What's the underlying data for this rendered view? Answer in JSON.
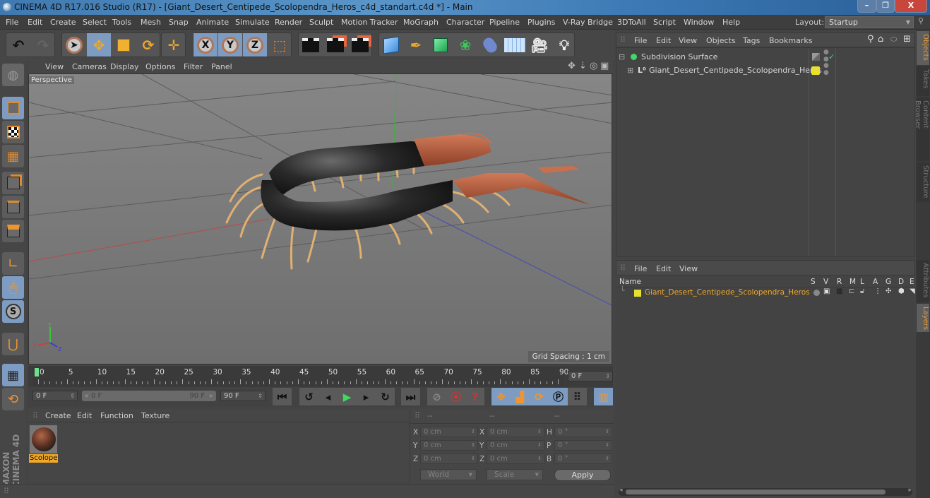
{
  "window": {
    "title": "CINEMA 4D R17.016 Studio (R17) - [Giant_Desert_Centipede_Scolopendra_Heros_c4d_standart.c4d *] - Main",
    "controls": {
      "minimize": "–",
      "maximize": "❐",
      "close": "X"
    }
  },
  "menubar": {
    "items": [
      "File",
      "Edit",
      "Create",
      "Select",
      "Tools",
      "Mesh",
      "Snap",
      "Animate",
      "Simulate",
      "Render",
      "Sculpt",
      "Motion Tracker",
      "MoGraph",
      "Character",
      "Pipeline",
      "Plugins",
      "V-Ray Bridge",
      "3DToAll",
      "Script",
      "Window",
      "Help"
    ],
    "layout_label": "Layout:",
    "layout_value": "Startup"
  },
  "toolbar": {
    "undo": "↶",
    "axis_labels": [
      "X",
      "Y",
      "Z"
    ]
  },
  "viewport": {
    "menu": [
      "View",
      "Cameras",
      "Display",
      "Options",
      "Filter",
      "Panel"
    ],
    "camera_label": "Perspective",
    "grid_spacing": "Grid Spacing : 1 cm",
    "colors": {
      "x_axis": "#c83c3c",
      "y_axis": "#3cc83c",
      "z_axis": "#3c3cc8",
      "bg": "#7b7b7b"
    }
  },
  "timeline": {
    "ticks": [
      "0",
      "5",
      "10",
      "15",
      "20",
      "25",
      "30",
      "35",
      "40",
      "45",
      "50",
      "55",
      "60",
      "65",
      "70",
      "75",
      "80",
      "85",
      "90"
    ],
    "current_frame": "0 F",
    "start_field": "0 F",
    "range_start": "0 F",
    "range_end": "90 F",
    "end_field": "90 F"
  },
  "material_manager": {
    "menu": [
      "Create",
      "Edit",
      "Function",
      "Texture"
    ],
    "materials": [
      {
        "name": "Scolope"
      }
    ]
  },
  "coordinates": {
    "headers": [
      "--",
      "--",
      "--"
    ],
    "rows": [
      {
        "pos_label": "X",
        "pos": "0 cm",
        "size_label": "X",
        "size": "0 cm",
        "rot_label": "H",
        "rot": "0 °"
      },
      {
        "pos_label": "Y",
        "pos": "0 cm",
        "size_label": "Y",
        "size": "0 cm",
        "rot_label": "P",
        "rot": "0 °"
      },
      {
        "pos_label": "Z",
        "pos": "0 cm",
        "size_label": "Z",
        "size": "0 cm",
        "rot_label": "B",
        "rot": "0 °"
      }
    ],
    "mode": "World",
    "transform": "Scale",
    "apply": "Apply"
  },
  "object_manager": {
    "menu": [
      "File",
      "Edit",
      "View",
      "Objects",
      "Tags",
      "Bookmarks"
    ],
    "objects": [
      {
        "name": "Subdivision Surface",
        "expand": "⊟",
        "icon_color": "#3fd86a"
      },
      {
        "name": "Giant_Desert_Centipede_Scolopendra_Heros",
        "expand": "⊞",
        "icon_color": "#e8e030"
      }
    ]
  },
  "layer_manager": {
    "menu": [
      "File",
      "Edit",
      "View"
    ],
    "columns": [
      "Name",
      "S",
      "V",
      "R",
      "M",
      "L",
      "A",
      "G",
      "D",
      "E"
    ],
    "layers": [
      {
        "name": "Giant_Desert_Centipede_Scolopendra_Heros",
        "color": "#e8e030"
      }
    ]
  },
  "side_tabs": {
    "top": [
      "Objects",
      "Takes",
      "Content Browser",
      "Structure"
    ],
    "bottom": [
      "Attributes",
      "Layers"
    ]
  },
  "branding": {
    "logo": "MAXON CINEMA 4D"
  }
}
